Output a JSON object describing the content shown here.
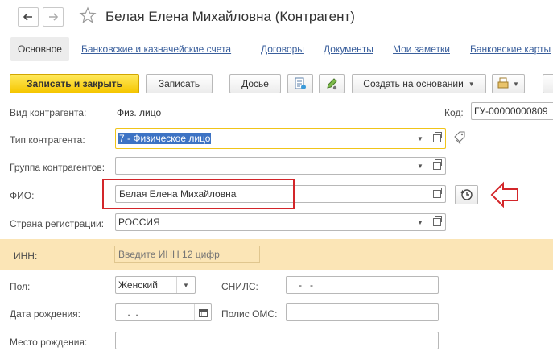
{
  "window": {
    "title": "Белая Елена Михайловна (Контрагент)",
    "back_icon": "arrow-left-icon",
    "forward_icon": "arrow-right-icon",
    "favorite_icon": "star-outline-icon"
  },
  "tabs": [
    {
      "label": "Основное",
      "active": true
    },
    {
      "label": "Банковские и казначейские счета"
    },
    {
      "label": "Договоры"
    },
    {
      "label": "Документы"
    },
    {
      "label": "Мои заметки"
    },
    {
      "label": "Банковские карты"
    }
  ],
  "toolbar": {
    "save_close": "Записать и закрыть",
    "save": "Записать",
    "dossier": "Досье",
    "create_based": "Создать на основании"
  },
  "form": {
    "kind_label": "Вид контрагента:",
    "kind_value": "Физ. лицо",
    "code_label": "Код:",
    "code_value": "ГУ-00000000809",
    "type_label": "Тип контрагента:",
    "type_value": "7 - Физическое лицо",
    "group_label": "Группа контрагентов:",
    "group_value": "",
    "fio_label": "ФИО:",
    "fio_value": "Белая Елена Михайловна",
    "country_label": "Страна регистрации:",
    "country_value": "РОССИЯ",
    "inn_label": "ИНН:",
    "inn_placeholder": "Введите ИНН 12 цифр",
    "gender_label": "Пол:",
    "gender_value": "Женский",
    "snils_label": "СНИЛС:",
    "snils_value": "-   -",
    "birthdate_label": "Дата рождения:",
    "birthdate_value": " .  .",
    "oms_label": "Полис ОМС:",
    "oms_value": "",
    "birthplace_label": "Место рождения:",
    "birthplace_value": ""
  },
  "colors": {
    "accent_yellow": "#f5c600",
    "highlight_red": "#d3262a",
    "link_blue": "#3a5f9c",
    "inn_band": "#fbe5b6"
  }
}
